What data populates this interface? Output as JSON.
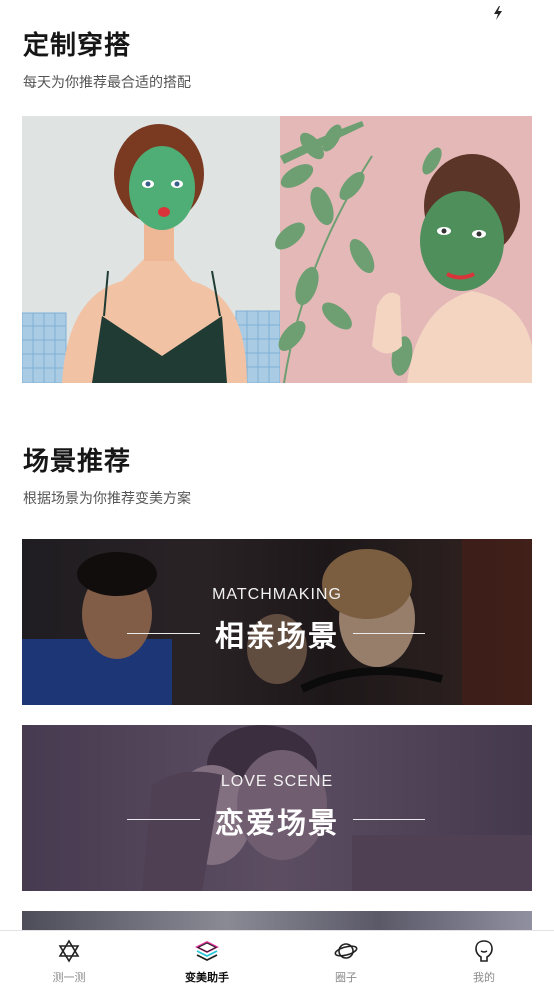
{
  "status_bar": {
    "icons": [
      "flash-icon"
    ]
  },
  "custom_outfit": {
    "title": "定制穿搭",
    "subtitle": "每天为你推荐最合适的搭配"
  },
  "scene_recommend": {
    "title": "场景推荐",
    "subtitle": "根据场景为你推荐变美方案",
    "banners": [
      {
        "en": "MATCHMAKING",
        "cn": "相亲场景"
      },
      {
        "en": "LOVE SCENE",
        "cn": "恋爱场景"
      }
    ]
  },
  "tab_bar": {
    "tabs": [
      {
        "label": "测一测",
        "icon": "star-of-david-icon",
        "active": false
      },
      {
        "label": "变美助手",
        "icon": "layers-icon",
        "active": true
      },
      {
        "label": "圈子",
        "icon": "planet-icon",
        "active": false
      },
      {
        "label": "我的",
        "icon": "face-icon",
        "active": false
      }
    ]
  },
  "colors": {
    "active_tab": "#111111",
    "inactive_tab": "#8a8a8a",
    "accent_magenta": "#e0339a",
    "accent_cyan": "#27c6d9"
  }
}
